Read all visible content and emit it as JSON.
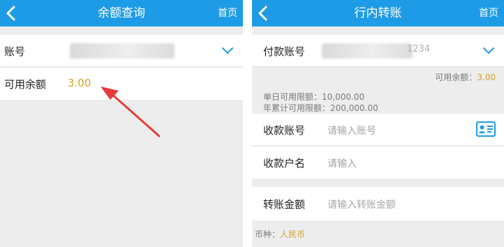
{
  "left": {
    "header": {
      "title": "余额查询",
      "home": "首页"
    },
    "account": {
      "label": "账号"
    },
    "balance": {
      "label": "可用余额",
      "value": "3.00"
    }
  },
  "right": {
    "header": {
      "title": "行内转账",
      "home": "首页"
    },
    "payer": {
      "label": "付款账号",
      "masked_tail": "1234"
    },
    "available": {
      "label": "可用余额：",
      "value": "3.00"
    },
    "limits": {
      "daily": "单日可用限额：10,000.00",
      "yearly": "年累计可用限额：200,000.00"
    },
    "payee_account": {
      "label": "收款账号",
      "placeholder": "请输入账号"
    },
    "payee_name": {
      "label": "收款户名",
      "placeholder": "请输入"
    },
    "amount": {
      "label": "转账金额",
      "placeholder": "请输入转账金额"
    },
    "currency": {
      "label": "币种：",
      "value": "人民币"
    }
  },
  "colors": {
    "header": "#1e9be6",
    "accent_gold": "#d9a023",
    "arrow": "#e63c3c",
    "chevron": "#1e9be6"
  },
  "icons": [
    "back-arrow-icon",
    "chevron-down-icon",
    "id-card-icon",
    "red-pointer-arrow"
  ]
}
